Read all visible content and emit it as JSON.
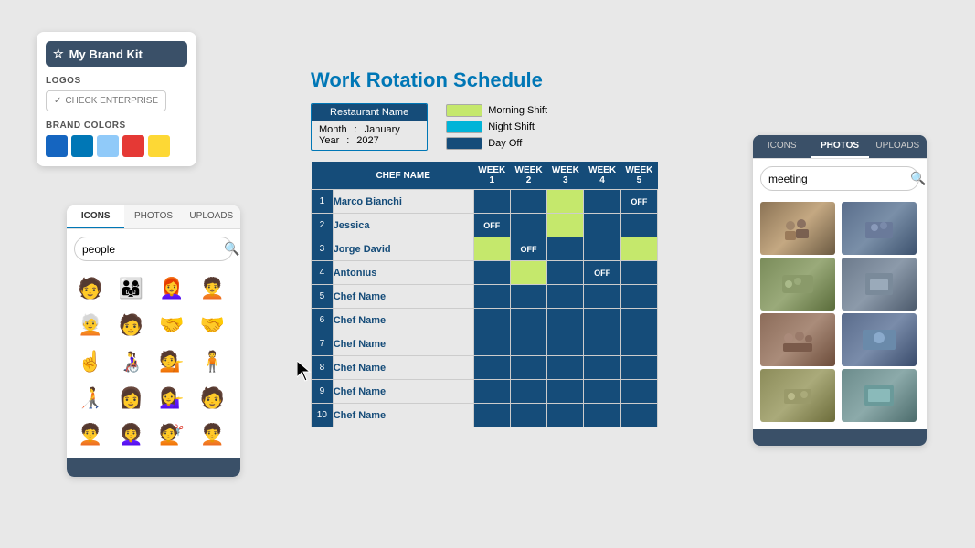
{
  "brand_kit": {
    "title": "My Brand Kit",
    "logos_label": "LOGOS",
    "check_enterprise": "CHECK ENTERPRISE",
    "brand_colors_label": "BRAND COLORS",
    "swatches": [
      "#1565c0",
      "#0077b6",
      "#90caf9",
      "#e53935",
      "#fdd835"
    ]
  },
  "icons_panel": {
    "tabs": [
      "ICONS",
      "PHOTOS",
      "UPLOADS"
    ],
    "active_tab": "ICONS",
    "search_placeholder": "people",
    "search_value": "people",
    "icons": [
      "🧑",
      "👨‍👩‍👧",
      "👩‍🦰",
      "🧑‍🦱",
      "🧑‍🦳",
      "🧑",
      "🤝",
      "🤝",
      "👆",
      "👩‍🦽",
      "💁",
      "🧍",
      "🧑‍🦯",
      "👩",
      "💁‍♀️",
      "🧑",
      "🧑‍🦱",
      "👩‍🦱",
      "💇",
      "🧑‍🦱"
    ]
  },
  "schedule": {
    "title": "Work Rotation Schedule",
    "restaurant_label": "Restaurant Name",
    "month_label": "Month",
    "month_value": "January",
    "year_label": "Year",
    "year_value": "2027",
    "legend": {
      "morning_shift": "Morning Shift",
      "night_shift": "Night Shift",
      "day_off": "Day Off"
    },
    "columns": [
      "",
      "CHEF NAME",
      "WEEK 1",
      "WEEK 2",
      "WEEK 3",
      "WEEK 4",
      "WEEK 5"
    ],
    "rows": [
      {
        "num": 1,
        "name": "Marco Bianchi",
        "weeks": [
          "night",
          "night",
          "morning",
          "night",
          "off"
        ]
      },
      {
        "num": 2,
        "name": "Jessica",
        "weeks": [
          "off",
          "night",
          "morning",
          "night",
          "night"
        ]
      },
      {
        "num": 3,
        "name": "Jorge David",
        "weeks": [
          "morning",
          "off",
          "night",
          "night",
          "morning"
        ]
      },
      {
        "num": 4,
        "name": "Antonius",
        "weeks": [
          "night",
          "morning",
          "night",
          "off",
          "night"
        ]
      },
      {
        "num": 5,
        "name": "Chef Name",
        "weeks": [
          "night",
          "night",
          "night",
          "night",
          "night"
        ]
      },
      {
        "num": 6,
        "name": "Chef Name",
        "weeks": [
          "night",
          "night",
          "night",
          "night",
          "night"
        ]
      },
      {
        "num": 7,
        "name": "Chef Name",
        "weeks": [
          "night",
          "night",
          "night",
          "night",
          "night"
        ]
      },
      {
        "num": 8,
        "name": "Chef Name",
        "weeks": [
          "night",
          "night",
          "night",
          "night",
          "night"
        ]
      },
      {
        "num": 9,
        "name": "Chef Name",
        "weeks": [
          "night",
          "night",
          "night",
          "night",
          "night"
        ]
      },
      {
        "num": 10,
        "name": "Chef Name",
        "weeks": [
          "night",
          "night",
          "night",
          "night",
          "night"
        ]
      }
    ]
  },
  "photos_panel": {
    "tabs": [
      "ICONS",
      "PHOTOS",
      "UPLOADS"
    ],
    "active_tab": "PHOTOS",
    "search_value": "meeting",
    "search_placeholder": "meeting"
  }
}
